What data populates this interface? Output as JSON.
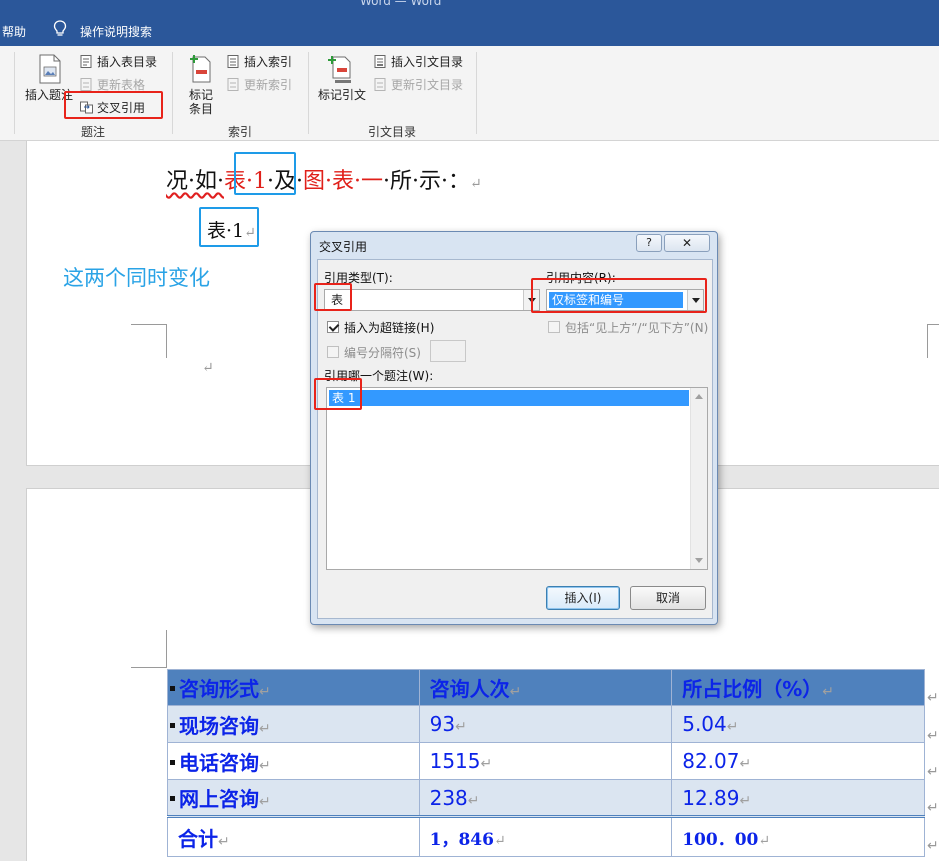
{
  "window": {
    "title": "Word — Word",
    "tabs": {
      "help": "帮助",
      "tell_me": "操作说明搜索"
    }
  },
  "ribbon": {
    "captions": {
      "group_label": "题注",
      "insert_caption": "插入题注",
      "insert_table_of_figures": "插入表目录",
      "update_table": "更新表格",
      "cross_reference": "交叉引用"
    },
    "index": {
      "group_label": "索引",
      "mark_entry_line1": "标记",
      "mark_entry_line2": "条目",
      "insert_index": "插入索引",
      "update_index": "更新索引"
    },
    "toa": {
      "group_label": "引文目录",
      "mark_citation": "标记引文",
      "insert_toa": "插入引文目录",
      "update_toa": "更新引文目录"
    }
  },
  "document": {
    "line1": {
      "part1": "况·如·",
      "ref1": "表·1",
      "part2": "·及·",
      "ref2": "图·表·一",
      "part3": "·所·示·：",
      "return": "↵"
    },
    "caption": {
      "text": "表·1",
      "return": "↵"
    },
    "annotation": "这两个同时变化",
    "empty_return": "↵",
    "table": {
      "headers": [
        "咨询形式",
        "咨询人次",
        "所占比例（%）"
      ],
      "rows": [
        [
          "现场咨询",
          "93",
          "5.04"
        ],
        [
          "电话咨询",
          "1515",
          "82.07"
        ],
        [
          "网上咨询",
          "238",
          "12.89"
        ]
      ],
      "total": [
        "合计",
        "1，846",
        "100．00"
      ],
      "return": "↵"
    }
  },
  "dialog": {
    "title": "交叉引用",
    "help_button": "?",
    "close_button": "✕",
    "reference_type_label": "引用类型(T):",
    "reference_type_value": "表",
    "insert_reference_to_label": "引用内容(R):",
    "insert_reference_to_value": "仅标签和编号",
    "insert_as_hyperlink": "插入为超链接(H)",
    "include_above_below": "包括“见上方”/“见下方”(N)",
    "separate_numbers": "编号分隔符(S)",
    "for_which_caption_label": "引用哪一个题注(W):",
    "caption_items": [
      "表 1"
    ],
    "insert_button": "插入(I)",
    "cancel_button": "取消"
  },
  "colors": {
    "title_bar": "#2b579a",
    "highlight_red": "#e8231a",
    "highlight_blue": "#1e9be8",
    "ref_red": "#e0201a",
    "table_header": "#4f81bd",
    "table_band": "#dbe5f1",
    "table_text": "#0c24e8",
    "selection": "#3399ff"
  }
}
